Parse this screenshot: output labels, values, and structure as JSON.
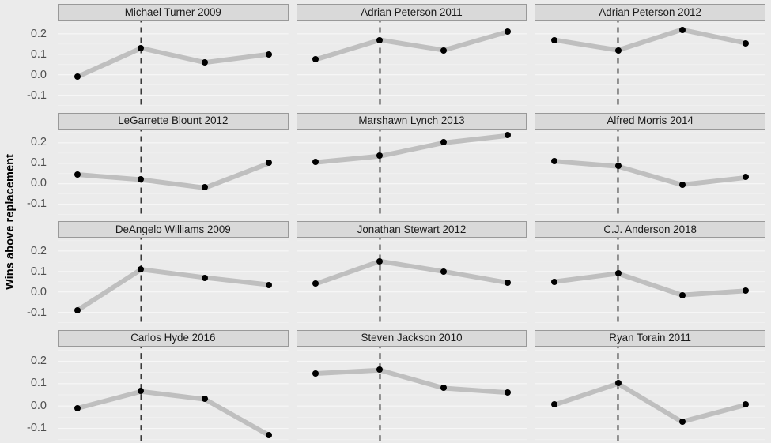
{
  "chart_data": {
    "type": "line",
    "title": "",
    "xlabel": "",
    "ylabel": "Wins above replacement",
    "ylim": [
      -0.165,
      0.265
    ],
    "yticks": [
      0.2,
      0.1,
      0.0,
      -0.1
    ],
    "ytick_labels": [
      "0.2",
      "0.1",
      "0.0",
      "-0.1"
    ],
    "grid": true,
    "legend": "none",
    "x_positions": [
      1,
      2,
      3,
      4
    ],
    "vertical_reference_line_x": 2,
    "annotations": "Dashed vertical reference line drawn at the second x position in every panel",
    "colors": {
      "background": "#ebebeb",
      "panel_strip": "#d9d9d9",
      "strip_border": "#999999",
      "gridline": "#f7f7f7",
      "line": "#bfbfbf",
      "point": "#000000",
      "dashed_line": "#3a3a3a",
      "axis_text": "#4d4d4d",
      "axis_title": "#000000"
    },
    "facet_layout": {
      "rows": 4,
      "cols": 3
    },
    "facets": [
      {
        "name": "Michael Turner 2009",
        "values": [
          -0.01,
          0.13,
          0.06,
          0.1
        ]
      },
      {
        "name": "Adrian Peterson 2011",
        "values": [
          0.075,
          0.17,
          0.12,
          0.21
        ]
      },
      {
        "name": "Adrian Peterson 2012",
        "values": [
          0.17,
          0.12,
          0.22,
          0.155
        ]
      },
      {
        "name": "LeGarrette Blount 2012",
        "values": [
          0.045,
          0.02,
          -0.02,
          0.1
        ]
      },
      {
        "name": "Marshawn Lynch 2013",
        "values": [
          0.105,
          0.135,
          0.2,
          0.235
        ]
      },
      {
        "name": "Alfred Morris 2014",
        "values": [
          0.11,
          0.085,
          -0.005,
          0.03
        ]
      },
      {
        "name": "DeAngelo Williams 2009",
        "values": [
          -0.09,
          0.11,
          0.07,
          0.035
        ]
      },
      {
        "name": "Jonathan Stewart 2012",
        "values": [
          0.04,
          0.15,
          0.1,
          0.045
        ]
      },
      {
        "name": "C.J. Anderson 2018",
        "values": [
          0.05,
          0.09,
          -0.015,
          0.005
        ]
      },
      {
        "name": "Carlos Hyde 2016",
        "values": [
          -0.01,
          0.065,
          0.03,
          -0.13
        ]
      },
      {
        "name": "Steven Jackson 2010",
        "values": [
          0.145,
          0.16,
          0.08,
          0.06
        ]
      },
      {
        "name": "Ryan Torain 2011",
        "values": [
          0.005,
          0.1,
          -0.07,
          0.005
        ]
      }
    ]
  }
}
